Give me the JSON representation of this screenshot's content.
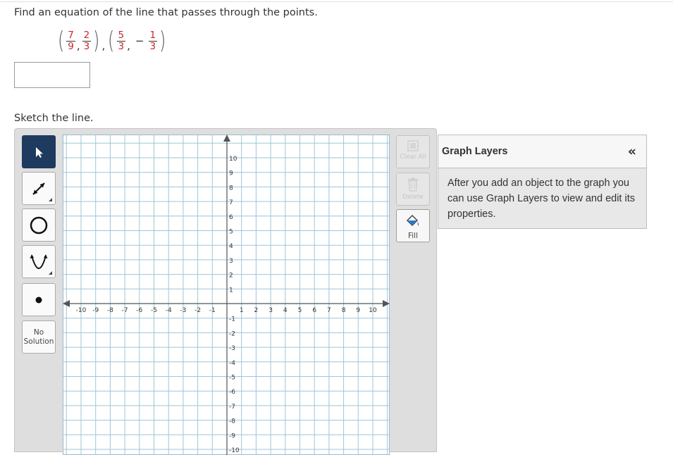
{
  "question": "Find an equation of the line that passes through the points.",
  "points": {
    "p1": {
      "x_num": "7",
      "x_den": "9",
      "y_num": "2",
      "y_den": "3"
    },
    "p2": {
      "x_num": "5",
      "x_den": "3",
      "y_sign": "−",
      "y_num": "1",
      "y_den": "3"
    }
  },
  "answer_value": "",
  "sketch_label": "Sketch the line.",
  "tools": {
    "no_solution_line1": "No",
    "no_solution_line2": "Solution"
  },
  "graph": {
    "xlim": [
      -10,
      10
    ],
    "ylim": [
      -10,
      10
    ],
    "x_ticks": [
      "-10",
      "-9",
      "-8",
      "-7",
      "-6",
      "-5",
      "-4",
      "-3",
      "-2",
      "-1",
      "1",
      "2",
      "3",
      "4",
      "5",
      "6",
      "7",
      "8",
      "9",
      "10"
    ],
    "y_ticks": [
      "10",
      "9",
      "8",
      "7",
      "6",
      "5",
      "4",
      "3",
      "2",
      "1",
      "-1",
      "-2",
      "-3",
      "-4",
      "-5",
      "-6",
      "-7",
      "-8",
      "-9",
      "-10"
    ],
    "grid_color": "#9ec6d8",
    "axis_color": "#555555"
  },
  "right_tools": {
    "clear_all": "Clear All",
    "delete": "Delete",
    "fill": "Fill"
  },
  "layers": {
    "title": "Graph Layers",
    "collapse_icon": "«",
    "text": "After you add an object to the graph you can use Graph Layers to view and edit its properties."
  }
}
